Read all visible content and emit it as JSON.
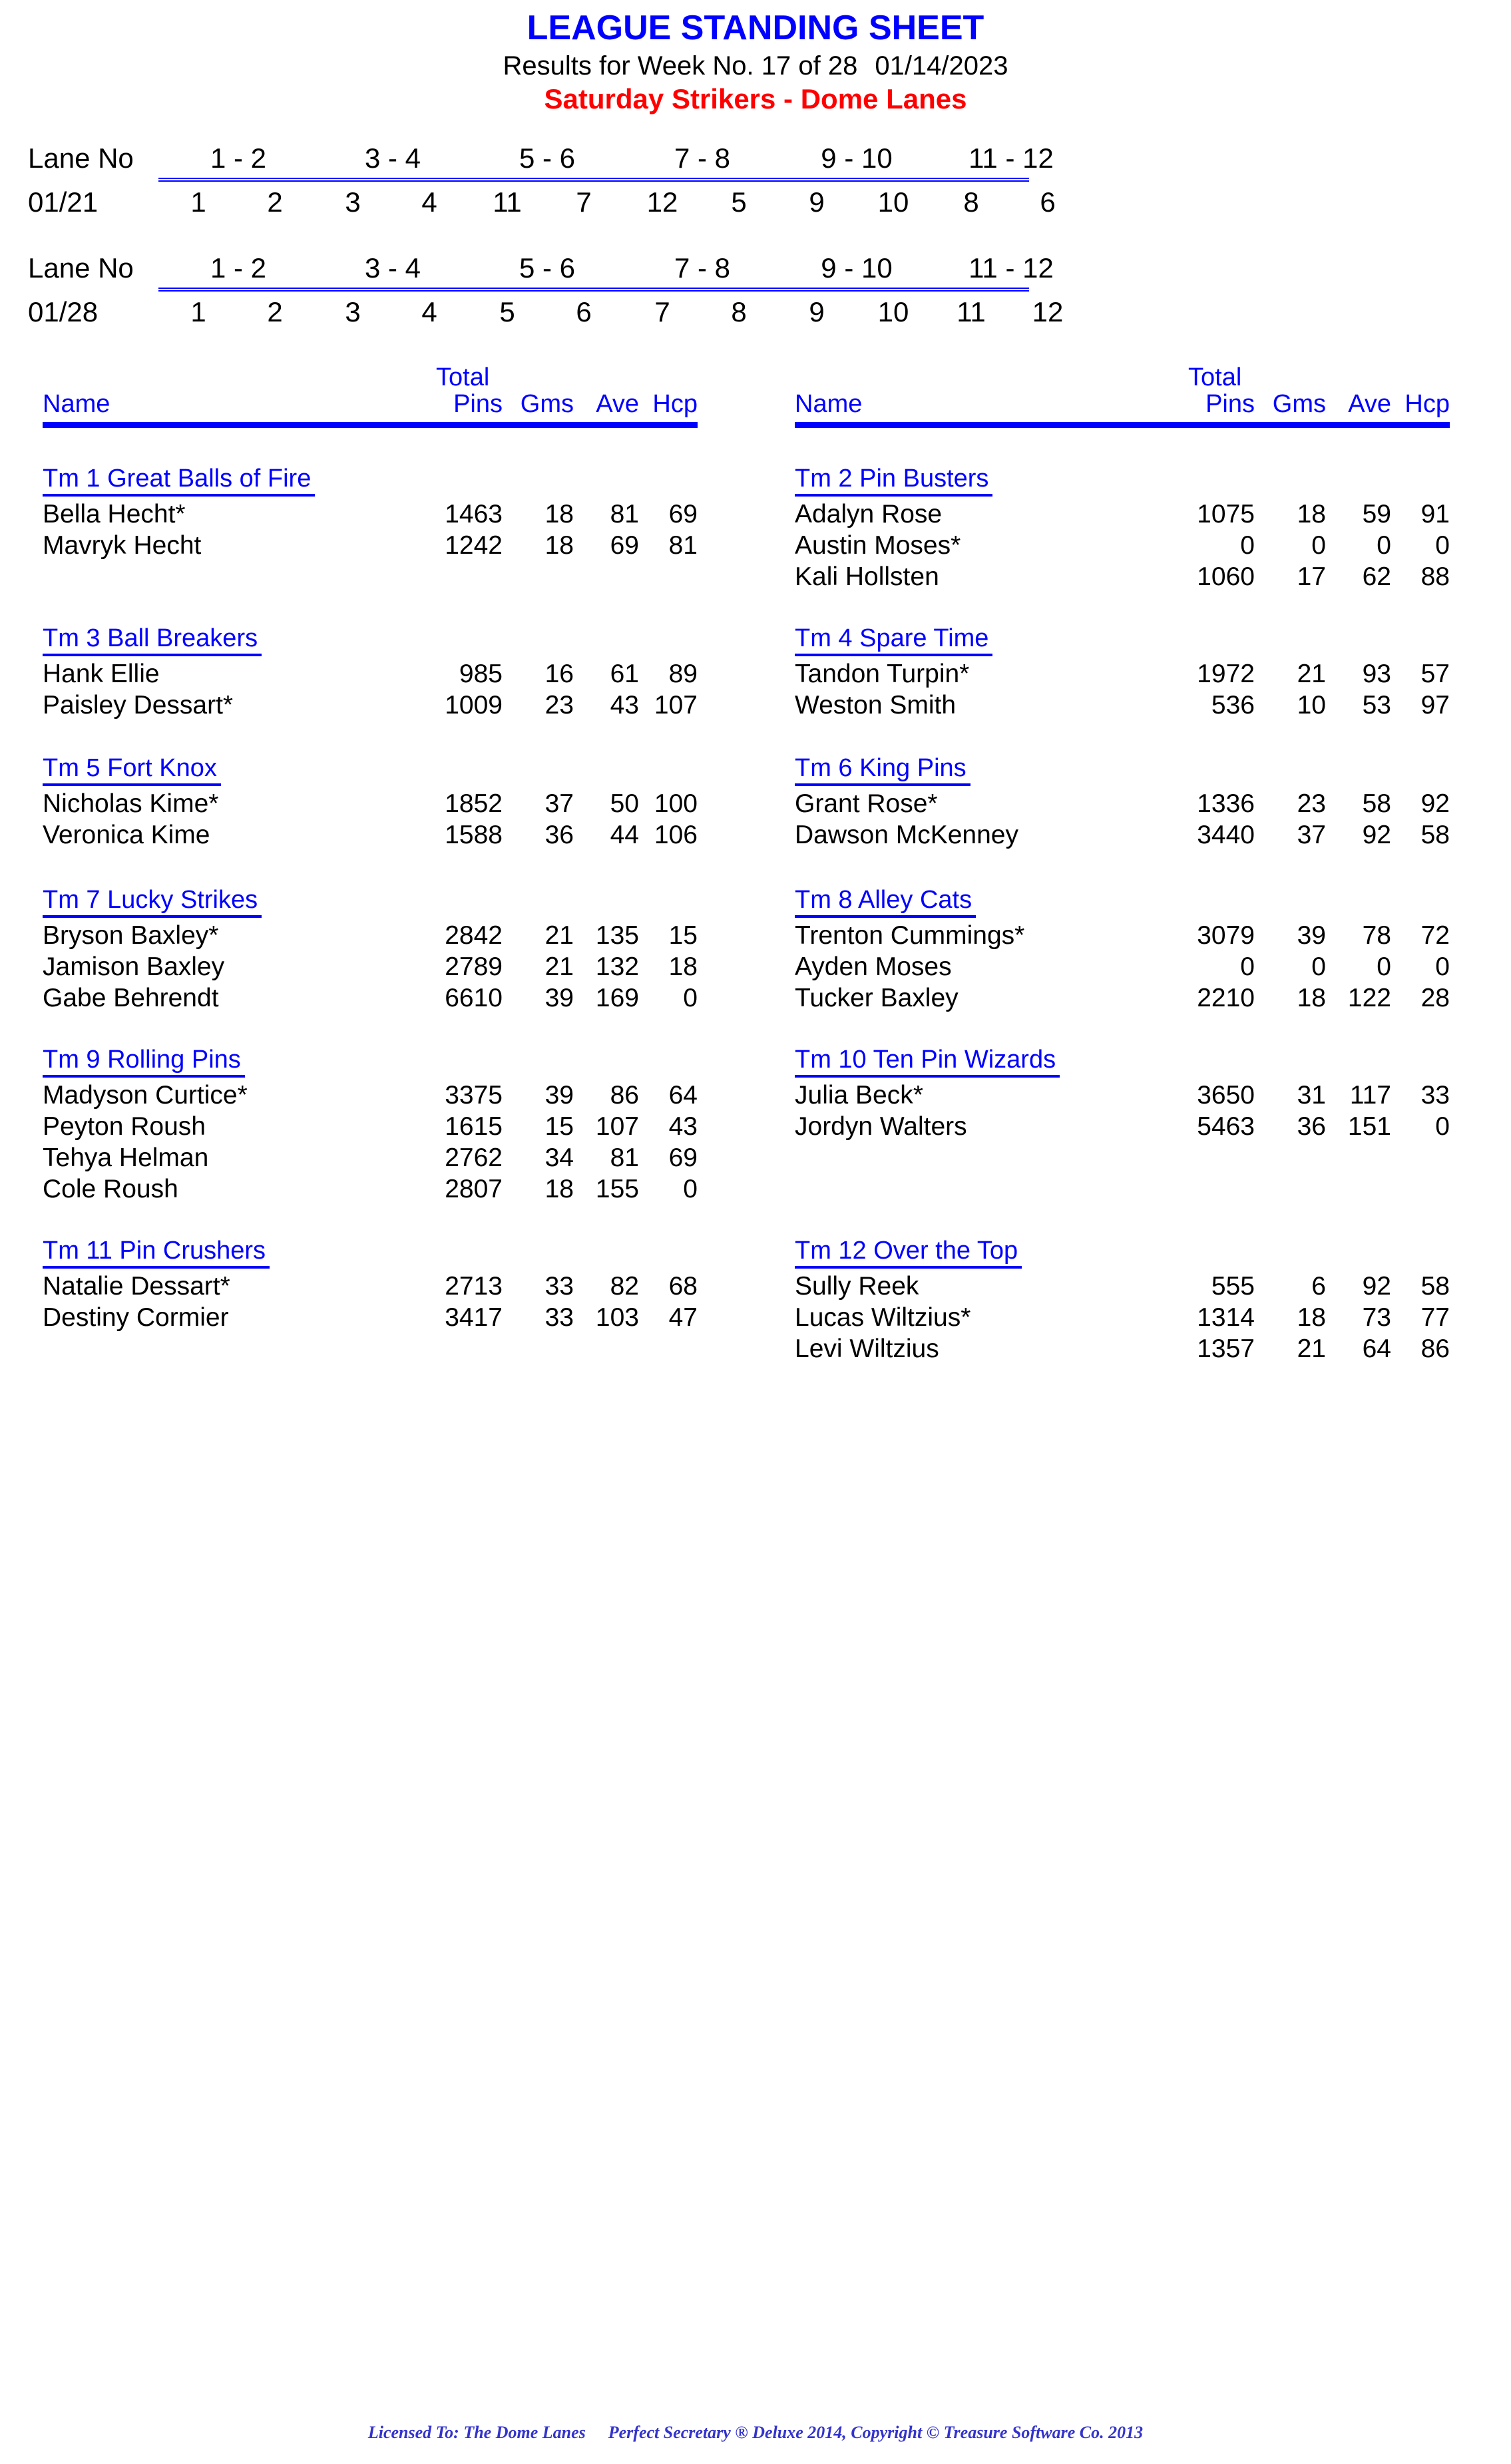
{
  "header": {
    "title": "LEAGUE STANDING SHEET",
    "results_line": "Results for Week No. 17 of 28",
    "date": "01/14/2023",
    "league": "Saturday Strikers - Dome Lanes",
    "title_color": "#0000FF",
    "league_color": "#FF0000"
  },
  "lane_schedules": [
    {
      "label": "Lane No",
      "pairs": [
        "1 - 2",
        "3 - 4",
        "5 - 6",
        "7 - 8",
        "9 - 10",
        "11 - 12"
      ],
      "date": "01/21",
      "teams": [
        "1",
        "2",
        "3",
        "4",
        "11",
        "7",
        "12",
        "5",
        "9",
        "10",
        "8",
        "6"
      ]
    },
    {
      "label": "Lane No",
      "pairs": [
        "1 - 2",
        "3 - 4",
        "5 - 6",
        "7 - 8",
        "9 - 10",
        "11 - 12"
      ],
      "date": "01/28",
      "teams": [
        "1",
        "2",
        "3",
        "4",
        "5",
        "6",
        "7",
        "8",
        "9",
        "10",
        "11",
        "12"
      ]
    }
  ],
  "column_header": {
    "total": "Total",
    "name": "Name",
    "pins": "Pins",
    "gms": "Gms",
    "ave": "Ave",
    "hcp": "Hcp"
  },
  "left_teams": [
    {
      "name": "Tm 1 Great Balls of Fire",
      "players": [
        {
          "name": "Bella Hecht*",
          "pins": "1463",
          "gms": "18",
          "ave": "81",
          "hcp": "69"
        },
        {
          "name": "Mavryk Hecht",
          "pins": "1242",
          "gms": "18",
          "ave": "69",
          "hcp": "81"
        }
      ]
    },
    {
      "name": "Tm 3 Ball Breakers",
      "players": [
        {
          "name": "Hank Ellie",
          "pins": "985",
          "gms": "16",
          "ave": "61",
          "hcp": "89"
        },
        {
          "name": "Paisley Dessart*",
          "pins": "1009",
          "gms": "23",
          "ave": "43",
          "hcp": "107"
        }
      ]
    },
    {
      "name": "Tm 5 Fort Knox",
      "players": [
        {
          "name": "Nicholas Kime*",
          "pins": "1852",
          "gms": "37",
          "ave": "50",
          "hcp": "100"
        },
        {
          "name": "Veronica Kime",
          "pins": "1588",
          "gms": "36",
          "ave": "44",
          "hcp": "106"
        }
      ]
    },
    {
      "name": "Tm 7 Lucky Strikes",
      "players": [
        {
          "name": "Bryson Baxley*",
          "pins": "2842",
          "gms": "21",
          "ave": "135",
          "hcp": "15"
        },
        {
          "name": "Jamison Baxley",
          "pins": "2789",
          "gms": "21",
          "ave": "132",
          "hcp": "18"
        },
        {
          "name": "Gabe Behrendt",
          "pins": "6610",
          "gms": "39",
          "ave": "169",
          "hcp": "0"
        }
      ]
    },
    {
      "name": "Tm 9 Rolling Pins",
      "players": [
        {
          "name": "Madyson Curtice*",
          "pins": "3375",
          "gms": "39",
          "ave": "86",
          "hcp": "64"
        },
        {
          "name": "Peyton Roush",
          "pins": "1615",
          "gms": "15",
          "ave": "107",
          "hcp": "43"
        },
        {
          "name": "Tehya Helman",
          "pins": "2762",
          "gms": "34",
          "ave": "81",
          "hcp": "69"
        },
        {
          "name": "Cole Roush",
          "pins": "2807",
          "gms": "18",
          "ave": "155",
          "hcp": "0"
        }
      ]
    },
    {
      "name": "Tm 11 Pin Crushers",
      "players": [
        {
          "name": "Natalie Dessart*",
          "pins": "2713",
          "gms": "33",
          "ave": "82",
          "hcp": "68"
        },
        {
          "name": "Destiny Cormier",
          "pins": "3417",
          "gms": "33",
          "ave": "103",
          "hcp": "47"
        }
      ]
    }
  ],
  "right_teams": [
    {
      "name": "Tm 2 Pin Busters",
      "players": [
        {
          "name": "Adalyn Rose",
          "pins": "1075",
          "gms": "18",
          "ave": "59",
          "hcp": "91"
        },
        {
          "name": "Austin Moses*",
          "pins": "0",
          "gms": "0",
          "ave": "0",
          "hcp": "0"
        },
        {
          "name": "Kali Hollsten",
          "pins": "1060",
          "gms": "17",
          "ave": "62",
          "hcp": "88"
        }
      ]
    },
    {
      "name": "Tm 4 Spare Time",
      "players": [
        {
          "name": "Tandon Turpin*",
          "pins": "1972",
          "gms": "21",
          "ave": "93",
          "hcp": "57"
        },
        {
          "name": "Weston Smith",
          "pins": "536",
          "gms": "10",
          "ave": "53",
          "hcp": "97"
        }
      ]
    },
    {
      "name": "Tm 6 King Pins",
      "players": [
        {
          "name": "Grant Rose*",
          "pins": "1336",
          "gms": "23",
          "ave": "58",
          "hcp": "92"
        },
        {
          "name": "Dawson McKenney",
          "pins": "3440",
          "gms": "37",
          "ave": "92",
          "hcp": "58"
        }
      ]
    },
    {
      "name": "Tm 8 Alley Cats",
      "players": [
        {
          "name": "Trenton Cummings*",
          "pins": "3079",
          "gms": "39",
          "ave": "78",
          "hcp": "72"
        },
        {
          "name": "Ayden Moses",
          "pins": "0",
          "gms": "0",
          "ave": "0",
          "hcp": "0"
        },
        {
          "name": "Tucker Baxley",
          "pins": "2210",
          "gms": "18",
          "ave": "122",
          "hcp": "28"
        }
      ]
    },
    {
      "name": "Tm 10 Ten Pin Wizards",
      "players": [
        {
          "name": "Julia Beck*",
          "pins": "3650",
          "gms": "31",
          "ave": "117",
          "hcp": "33"
        },
        {
          "name": "Jordyn Walters",
          "pins": "5463",
          "gms": "36",
          "ave": "151",
          "hcp": "0"
        }
      ]
    },
    {
      "name": "Tm 12 Over the Top",
      "players": [
        {
          "name": "Sully Reek",
          "pins": "555",
          "gms": "6",
          "ave": "92",
          "hcp": "58"
        },
        {
          "name": "Lucas Wiltzius*",
          "pins": "1314",
          "gms": "18",
          "ave": "73",
          "hcp": "77"
        },
        {
          "name": "Levi Wiltzius",
          "pins": "1357",
          "gms": "21",
          "ave": "64",
          "hcp": "86"
        }
      ]
    }
  ],
  "footer": {
    "licensed_to": "Licensed To: The Dome Lanes",
    "software": "Perfect Secretary ® Deluxe  2014, Copyright © Treasure Software Co. 2013"
  }
}
